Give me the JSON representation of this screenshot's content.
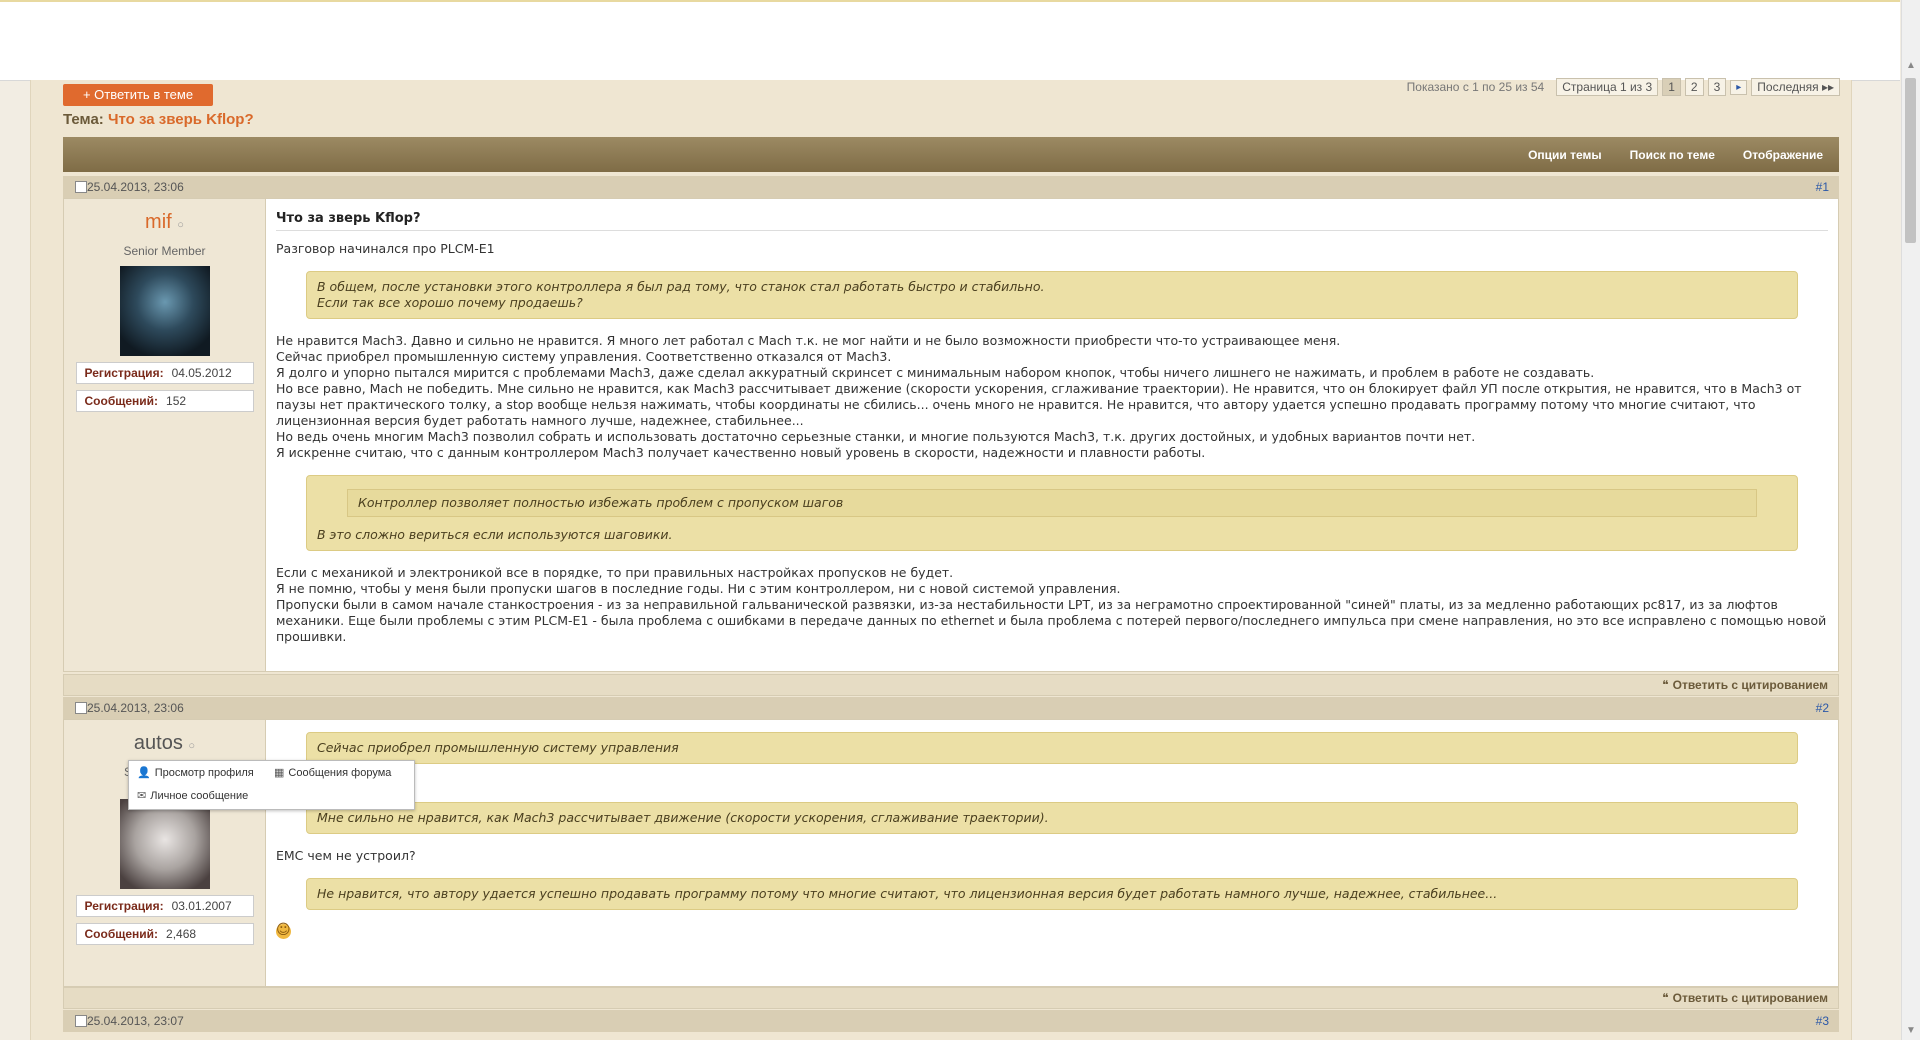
{
  "browser": {
    "menu_icon": "≡"
  },
  "toolbar": {
    "reply_button": "+ Ответить в теме",
    "showing": "Показано с 1 по 25 из 54",
    "page_label": "Страница 1 из 3",
    "pages": [
      "1",
      "2",
      "3"
    ],
    "next_icon": "▸",
    "last": "Последняя ▸▸"
  },
  "thread": {
    "label": "Тема:",
    "name": "Что за зверь Kflop?"
  },
  "tools": {
    "options": "Опции темы",
    "search": "Поиск по теме",
    "display": "Отображение"
  },
  "posts": [
    {
      "date": "25.04.2013, 23:06",
      "number": "#1",
      "username": "mif",
      "online_mark": "○",
      "title": "Senior Member",
      "reg_label": "Регистрация:",
      "reg_date": "04.05.2012",
      "msg_label": "Сообщений:",
      "msg_count": "152",
      "post_title": "Что за зверь Kflop?",
      "p1": "Разговор начинался про PLCM-E1",
      "q1": "В общем, после установки этого контроллера я был рад тому, что станок стал работать быстро и стабильно.\nЕсли так все хорошо почему продаешь?",
      "p2": "Не нравится Mach3. Давно и сильно не нравится. Я много лет работал с Mach т.к. не мог найти и не было возможности приобрести что-то устраивающее меня.\nСейчас приобрел промышленную систему управления. Соответственно отказался от Mach3.\nЯ долго и упорно пытался мирится с проблемами Mach3, даже сделал аккуратный скринсет с минимальным набором кнопок, чтобы ничего лишнего не нажимать, и проблем в работе не создавать.\nНо все равно, Mach не победить. Мне сильно не нравится, как Mach3 рассчитывает движение (скорости ускорения, сглаживание траектории). Не нравится, что он блокирует файл УП после открытия, не нравится, что в Mach3 от паузы нет практического толку, а stop вообще нельзя нажимать, чтобы координаты не сбились... очень много не нравится. Не нравится, что автору удается успешно продавать программу потому что многие считают, что лицензионная версия будет работать намного лучше, надежнее, стабильнее...\nНо ведь очень многим Mach3 позволил собрать и использовать достаточно серьезные станки, и многие пользуются Mach3, т.к. других достойных, и удобных вариантов почти нет.\nЯ искренне считаю, что с данным контроллером Mach3 получает качественно новый уровень в скорости, надежности и плавности работы.",
      "q2_inner": "Контроллер позволяет полностью избежать проблем с пропуском шагов",
      "q2": "В это сложно вериться если используются шаговики.",
      "p3": "Если с механикой и электроникой все в порядке, то при правильных настройках пропусков не будет.\nЯ не помню, чтобы у меня были пропуски шагов в последние годы. Ни с этим контроллером, ни с новой системой управления.\nПропуски были в самом начале станкостроения - из за неправильной гальванической развязки, из-за нестабильности LPT, из за неграмотно спроектированной \"синей\" платы, из за медленно работающих pc817, из за люфтов механики. Еще были проблемы с этим PLCM-E1 - была проблема с ошибками в передаче данных по ethernet и была проблема с потерей первого/последнего импульса при смене направления, но это все исправлено с помощью новой прошивки.",
      "reply_quote": "Ответить с цитированием"
    },
    {
      "date": "25.04.2013, 23:06",
      "number": "#2",
      "username": "autos",
      "online_mark": "○",
      "title": "S",
      "reg_label": "Регистрация:",
      "reg_date": "03.01.2007",
      "msg_label": "Сообщений:",
      "msg_count": "2,468",
      "q1": "Сейчас приобрел промышленную систему управления",
      "p1_tail": "?",
      "q2": "Мне сильно не нравится, как Mach3 рассчитывает движение (скорости ускорения, сглаживание траектории).",
      "p2": "EMC чем не устроил?",
      "q3": "Не нравится, что автору удается успешно продавать программу потому что многие считают, что лицензионная версия будет работать намного лучше, надежнее, стабильнее...",
      "reply_quote": "Ответить с цитированием"
    },
    {
      "date": "25.04.2013, 23:07",
      "number": "#3"
    }
  ],
  "popup": {
    "profile": "Просмотр профиля",
    "forum_posts": "Сообщения форума",
    "private_message": "Личное сообщение"
  },
  "colors": {
    "accent": "#e06a2e",
    "header_band": "#8c7a52",
    "quote": "#ece0a6",
    "link": "#2b58a8"
  }
}
